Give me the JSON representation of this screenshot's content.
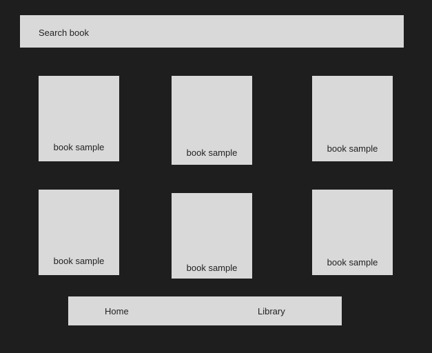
{
  "search": {
    "placeholder": "Search book"
  },
  "books": [
    {
      "label": "book sample"
    },
    {
      "label": "book sample"
    },
    {
      "label": "book sample"
    },
    {
      "label": "book sample"
    },
    {
      "label": "book sample"
    },
    {
      "label": "book sample"
    }
  ],
  "nav": {
    "home_label": "Home",
    "library_label": "Library"
  },
  "colors": {
    "background": "#1e1e1e",
    "block": "#d9d9d9",
    "text": "#222222"
  }
}
